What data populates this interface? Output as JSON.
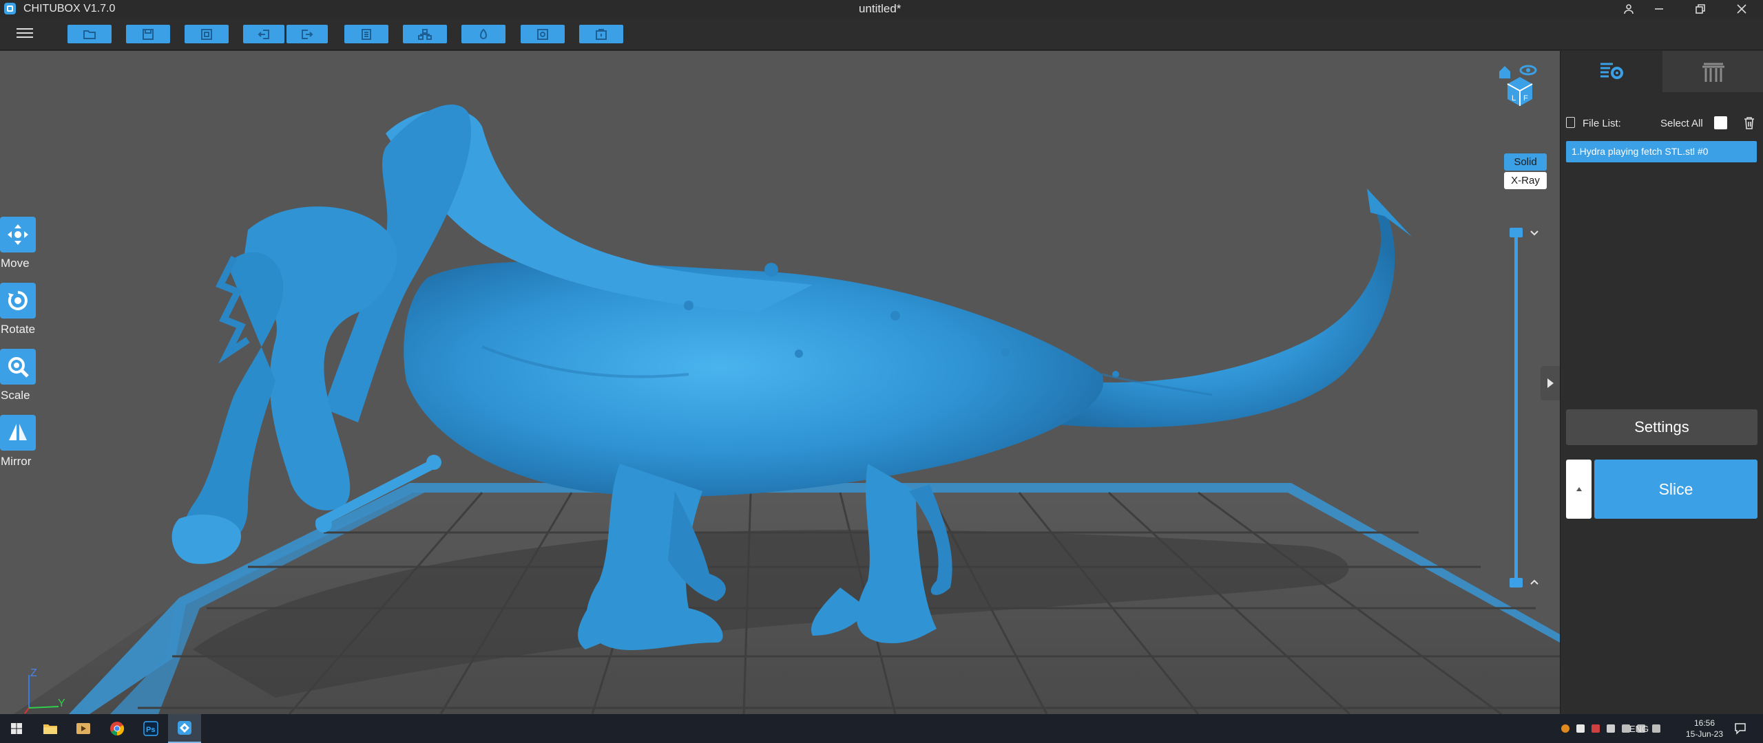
{
  "window": {
    "app_title": "CHITUBOX V1.7.0",
    "doc_title": "untitled*",
    "controls": [
      "account-icon",
      "minimize-icon",
      "restore-icon",
      "close-icon"
    ]
  },
  "toolbar": {
    "menu_icon": "hamburger-icon",
    "buttons": [
      "open-file-icon",
      "save-icon",
      "select-icon",
      "import-icon",
      "export-icon",
      "document-icon",
      "network-icon",
      "lamp-icon",
      "support-icon",
      "slice-box-icon"
    ]
  },
  "tools": {
    "move": "Move",
    "rotate": "Rotate",
    "scale": "Scale",
    "mirror": "Mirror"
  },
  "view": {
    "solid": "Solid",
    "xray": "X-Ray",
    "active_mode": "Solid"
  },
  "axes": {
    "z": "Z",
    "y": "Y"
  },
  "panel": {
    "file_list_label": "File List:",
    "select_all_label": "Select All",
    "files": [
      "1.Hydra playing fetch STL.stl #0"
    ],
    "settings_label": "Settings",
    "slice_label": "Slice"
  },
  "taskbar": {
    "apps": [
      "windows-start-icon",
      "file-explorer-icon",
      "media-player-icon",
      "chrome-icon",
      "photoshop-icon",
      "chitubox-icon"
    ],
    "photoshop_text": "Ps",
    "language": "ENG",
    "time": "16:56",
    "date": "15-Jun-23"
  },
  "colors": {
    "accent": "#3ba0e5",
    "model": "#2f93d4",
    "viewport_bg": "#565656",
    "panel_bg": "#2d2d2d"
  }
}
